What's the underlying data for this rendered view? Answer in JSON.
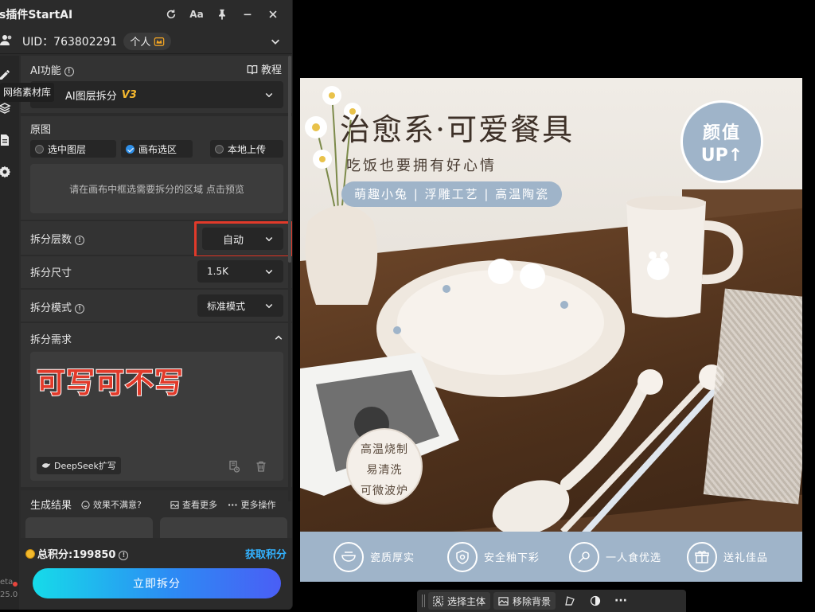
{
  "app": {
    "title": "s插件StartAI",
    "title_tools": [
      "refresh-icon",
      "font-size-icon",
      "pin-icon",
      "minimize-icon",
      "close-icon"
    ],
    "font_tool_label": "Aa"
  },
  "account": {
    "uid": "UID：763802291",
    "plan": "个人"
  },
  "sidebar": {
    "tooltip": "网络素材库",
    "icons": [
      "pencil-icon",
      "layers-icon",
      "document-icon",
      "gear-icon"
    ],
    "version_line1": "eta",
    "version_line2": "25.0"
  },
  "ai_function": {
    "label": "AI功能",
    "help_label": "教程",
    "selected": "AI图层拆分",
    "version_tag": "V3"
  },
  "source": {
    "label": "原图",
    "options": [
      "选中图层",
      "画布选区",
      "本地上传"
    ],
    "selected_index": 1,
    "hint": "请在画布中框选需要拆分的区域 点击预览"
  },
  "layers": {
    "label": "拆分层数",
    "value": "自动"
  },
  "size": {
    "label": "拆分尺寸",
    "value": "1.5K"
  },
  "mode": {
    "label": "拆分模式",
    "value": "标准模式"
  },
  "request": {
    "label": "拆分需求",
    "overlay_text": "可写可不写",
    "deepseek_label": "DeepSeek扩写"
  },
  "results": {
    "label": "生成结果",
    "unsatisfied": "效果不满意?",
    "view_more": "查看更多",
    "more_actions": "更多操作"
  },
  "footer": {
    "points": "总积分:199850",
    "get_points": "获取积分",
    "submit": "立即拆分"
  },
  "canvas_image": {
    "headline": "治愈系·可爱餐具",
    "subline": "吃饭也要拥有好心情",
    "pill": "萌趣小兔 | 浮雕工艺 | 高温陶瓷",
    "badge_line1": "颜值",
    "badge_line2": "UP↑",
    "features": [
      "高温烧制",
      "易清洗",
      "可微波炉"
    ],
    "bottom_items": [
      "瓷质厚实",
      "安全釉下彩",
      "一人食优选",
      "送礼佳品"
    ]
  },
  "float_toolbar": {
    "select_subject": "选择主体",
    "remove_bg": "移除背景"
  },
  "colors": {
    "accent": "#2e8fe8",
    "highlight_box": "#e13a2a",
    "version_tag": "#f5b82e",
    "get_points": "#33b2ff",
    "brand_blue": "#9fb4c9"
  }
}
